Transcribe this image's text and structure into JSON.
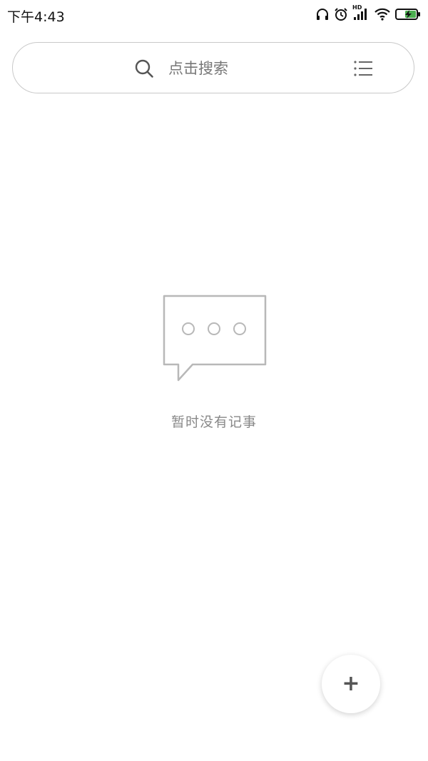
{
  "status_bar": {
    "time": "下午4:43",
    "hd_label": "HD",
    "icons": [
      "headphones-icon",
      "alarm-icon",
      "signal-icon",
      "wifi-icon",
      "battery-charging-icon"
    ]
  },
  "search": {
    "placeholder": "点击搜索"
  },
  "empty_state": {
    "message": "暂时没有记事"
  },
  "fab": {
    "label": "+"
  },
  "colors": {
    "accent_battery": "#4caf50",
    "icon_gray": "#555555",
    "placeholder_gray": "#777777",
    "empty_text_gray": "#888888",
    "empty_icon_gray": "#b8b8b8"
  }
}
